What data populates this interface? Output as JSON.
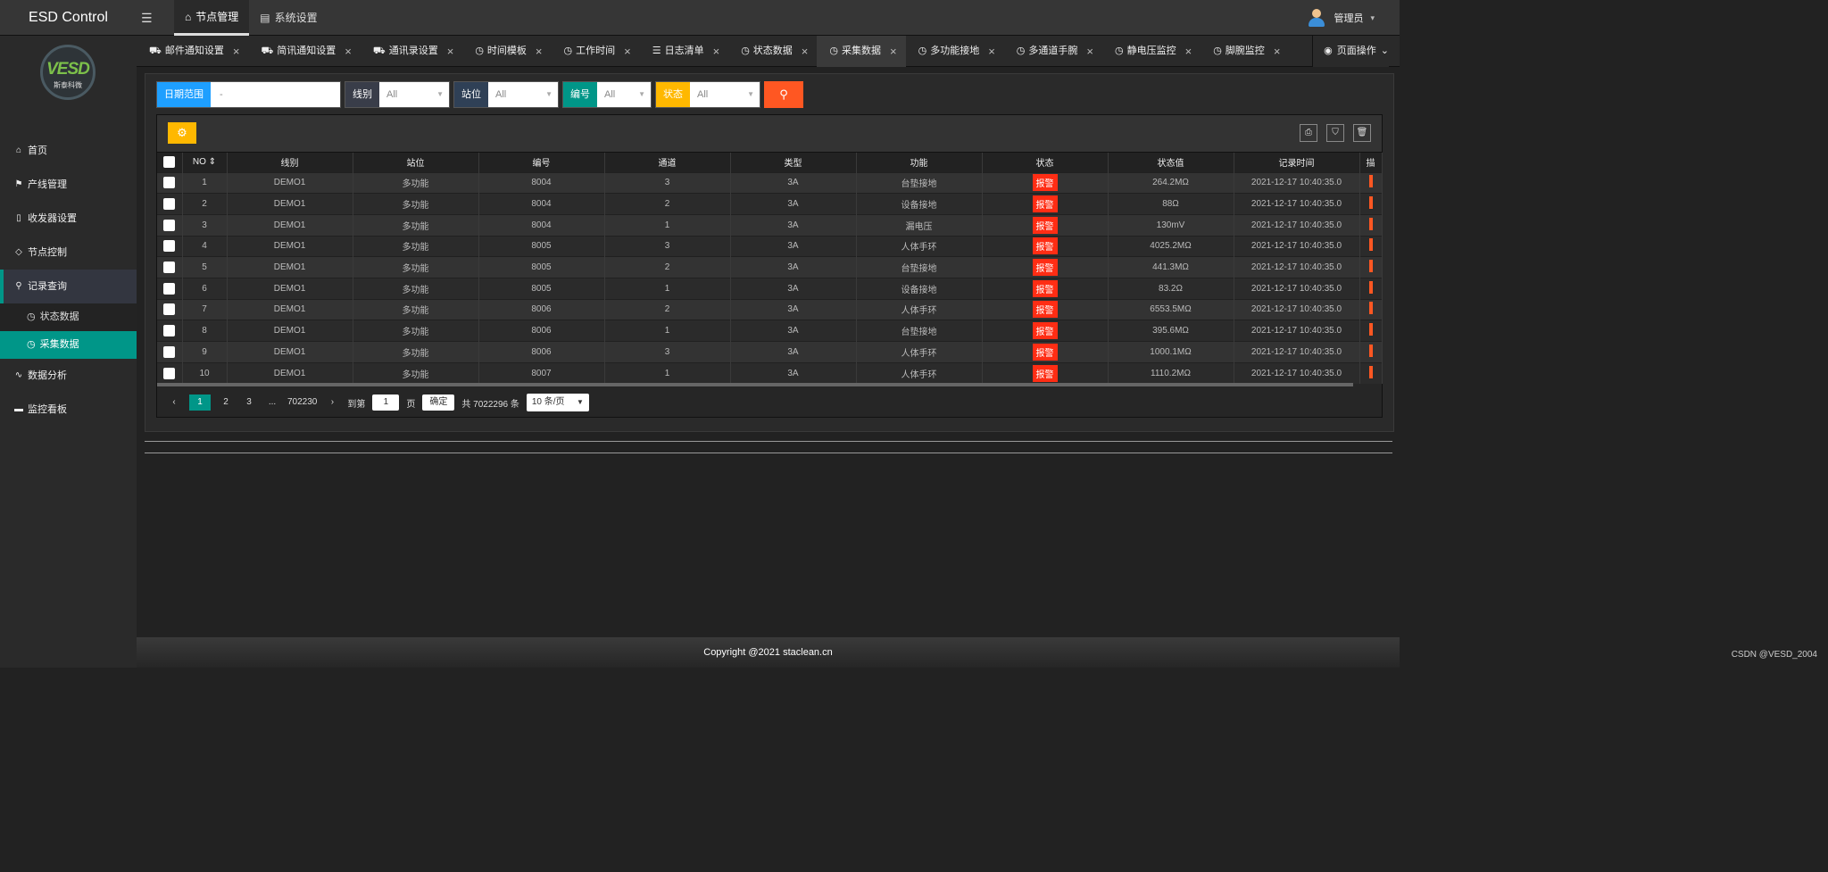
{
  "app": {
    "title": "ESD Control",
    "user": "管理员"
  },
  "topnav": [
    {
      "label": "节点管理",
      "icon": "tag-icon",
      "active": true
    },
    {
      "label": "系统设置",
      "icon": "clipboard-icon",
      "active": false
    }
  ],
  "logo": {
    "text": "VESD",
    "subtitle": "斯泰科微"
  },
  "sidebar": {
    "items": [
      {
        "label": "首页",
        "icon": "home-icon"
      },
      {
        "label": "产线管理",
        "icon": "flag-icon"
      },
      {
        "label": "收发器设置",
        "icon": "columns-icon"
      },
      {
        "label": "节点控制",
        "icon": "cube-icon"
      },
      {
        "label": "记录查询",
        "icon": "search-icon"
      },
      {
        "label": "状态数据",
        "icon": "clock-icon"
      },
      {
        "label": "采集数据",
        "icon": "clock-icon"
      },
      {
        "label": "数据分析",
        "icon": "pulse-icon"
      },
      {
        "label": "监控看板",
        "icon": "monitor-icon"
      }
    ]
  },
  "tabs": [
    {
      "label": "邮件通知设置",
      "icon": "car-icon"
    },
    {
      "label": "简讯通知设置",
      "icon": "car-icon"
    },
    {
      "label": "通讯录设置",
      "icon": "car-icon"
    },
    {
      "label": "时间模板",
      "icon": "clock-icon"
    },
    {
      "label": "工作时间",
      "icon": "clock-icon"
    },
    {
      "label": "日志清单",
      "icon": "list-icon"
    },
    {
      "label": "状态数据",
      "icon": "clock-icon"
    },
    {
      "label": "采集数据",
      "icon": "clock-icon",
      "active": true
    },
    {
      "label": "多功能接地",
      "icon": "clock-icon"
    },
    {
      "label": "多通道手腕",
      "icon": "clock-icon"
    },
    {
      "label": "静电压监控",
      "icon": "clock-icon"
    },
    {
      "label": "脚腕监控",
      "icon": "clock-icon"
    }
  ],
  "page_op": "页面操作",
  "filters": {
    "date_label": "日期范围",
    "date_value": "-",
    "line_label": "线别",
    "line_value": "All",
    "station_label": "站位",
    "station_value": "All",
    "number_label": "编号",
    "number_value": "All",
    "status_label": "状态",
    "status_value": "All",
    "colors": {
      "date": "#1e9fff",
      "line": "#393d49",
      "station": "#2f4056",
      "number": "#009688",
      "status": "#ffb800",
      "search": "#ff5722"
    }
  },
  "table": {
    "headers": [
      "NO",
      "线别",
      "站位",
      "编号",
      "通道",
      "类型",
      "功能",
      "状态",
      "状态值",
      "记录时间",
      "描"
    ],
    "rows": [
      [
        "1",
        "DEMO1",
        "多功能",
        "8004",
        "3",
        "3A",
        "台垫接地",
        "报警",
        "264.2MΩ",
        "2021-12-17 10:40:35.0"
      ],
      [
        "2",
        "DEMO1",
        "多功能",
        "8004",
        "2",
        "3A",
        "设备接地",
        "报警",
        "88Ω",
        "2021-12-17 10:40:35.0"
      ],
      [
        "3",
        "DEMO1",
        "多功能",
        "8004",
        "1",
        "3A",
        "漏电压",
        "报警",
        "130mV",
        "2021-12-17 10:40:35.0"
      ],
      [
        "4",
        "DEMO1",
        "多功能",
        "8005",
        "3",
        "3A",
        "人体手环",
        "报警",
        "4025.2MΩ",
        "2021-12-17 10:40:35.0"
      ],
      [
        "5",
        "DEMO1",
        "多功能",
        "8005",
        "2",
        "3A",
        "台垫接地",
        "报警",
        "441.3MΩ",
        "2021-12-17 10:40:35.0"
      ],
      [
        "6",
        "DEMO1",
        "多功能",
        "8005",
        "1",
        "3A",
        "设备接地",
        "报警",
        "83.2Ω",
        "2021-12-17 10:40:35.0"
      ],
      [
        "7",
        "DEMO1",
        "多功能",
        "8006",
        "2",
        "3A",
        "人体手环",
        "报警",
        "6553.5MΩ",
        "2021-12-17 10:40:35.0"
      ],
      [
        "8",
        "DEMO1",
        "多功能",
        "8006",
        "1",
        "3A",
        "台垫接地",
        "报警",
        "395.6MΩ",
        "2021-12-17 10:40:35.0"
      ],
      [
        "9",
        "DEMO1",
        "多功能",
        "8006",
        "3",
        "3A",
        "人体手环",
        "报警",
        "1000.1MΩ",
        "2021-12-17 10:40:35.0"
      ],
      [
        "10",
        "DEMO1",
        "多功能",
        "8007",
        "1",
        "3A",
        "人体手环",
        "报警",
        "1110.2MΩ",
        "2021-12-17 10:40:35.0"
      ]
    ]
  },
  "pager": {
    "pages": [
      "1",
      "2",
      "3",
      "...",
      "702230"
    ],
    "goto_label": "到第",
    "goto_value": "1",
    "page_unit": "页",
    "confirm": "确定",
    "total": "共 7022296 条",
    "per_page": "10 条/页"
  },
  "footer": {
    "copyright": "Copyright @2021 staclean.cn",
    "watermark": "CSDN @VESD_2004"
  }
}
